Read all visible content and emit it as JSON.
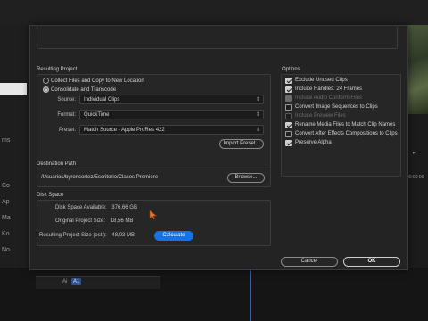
{
  "background": {
    "left_marks": [
      "ms",
      "Co",
      "Ap",
      "Ma",
      "Ko",
      "No"
    ],
    "right_marks": [
      "‣",
      "00:00:00"
    ],
    "timeline_cells": [
      "Ai",
      "A1"
    ]
  },
  "resulting_project": {
    "title": "Resulting Project",
    "option_collect": "Collect Files and Copy to New Location",
    "option_consolidate": "Consolidate and Transcode",
    "source_label": "Source:",
    "source_value": "Individual Clips",
    "format_label": "Format:",
    "format_value": "QuickTime",
    "preset_label": "Preset:",
    "preset_value": "Match Source - Apple ProRes 422",
    "import_preset_label": "Import Preset..."
  },
  "options": {
    "title": "Options",
    "items": [
      {
        "label": "Exclude Unused Clips",
        "checked": true,
        "enabled": true
      },
      {
        "label": "Include Handles:  24 Frames",
        "checked": true,
        "enabled": true
      },
      {
        "label": "Include Audio Conform Files",
        "checked": true,
        "enabled": false
      },
      {
        "label": "Convert Image Sequences to Clips",
        "checked": false,
        "enabled": true
      },
      {
        "label": "Include Preview Files",
        "checked": false,
        "enabled": false
      },
      {
        "label": "Rename Media Files to Match Clip Names",
        "checked": true,
        "enabled": true
      },
      {
        "label": "Convert After Effects Compositions to Clips",
        "checked": false,
        "enabled": true
      },
      {
        "label": "Preserve Alpha",
        "checked": true,
        "enabled": true
      }
    ]
  },
  "destination": {
    "title": "Destination Path",
    "path": "/Usuarios/byroncortez/Escritorio/Clases Premiere",
    "browse_label": "Browse..."
  },
  "disk_space": {
    "title": "Disk Space",
    "available_label": "Disk Space Available:",
    "available_value": "376,66 GB",
    "original_label": "Original Project Size:",
    "original_value": "18,56 MB",
    "resulting_label": "Resulting Project Size (est.):",
    "resulting_value": "48,03 MB",
    "calculate_label": "Calculate"
  },
  "footer": {
    "cancel_label": "Cancel",
    "ok_label": "OK"
  },
  "colors": {
    "accent": "#1473e6",
    "cursor": "#e8742c"
  }
}
